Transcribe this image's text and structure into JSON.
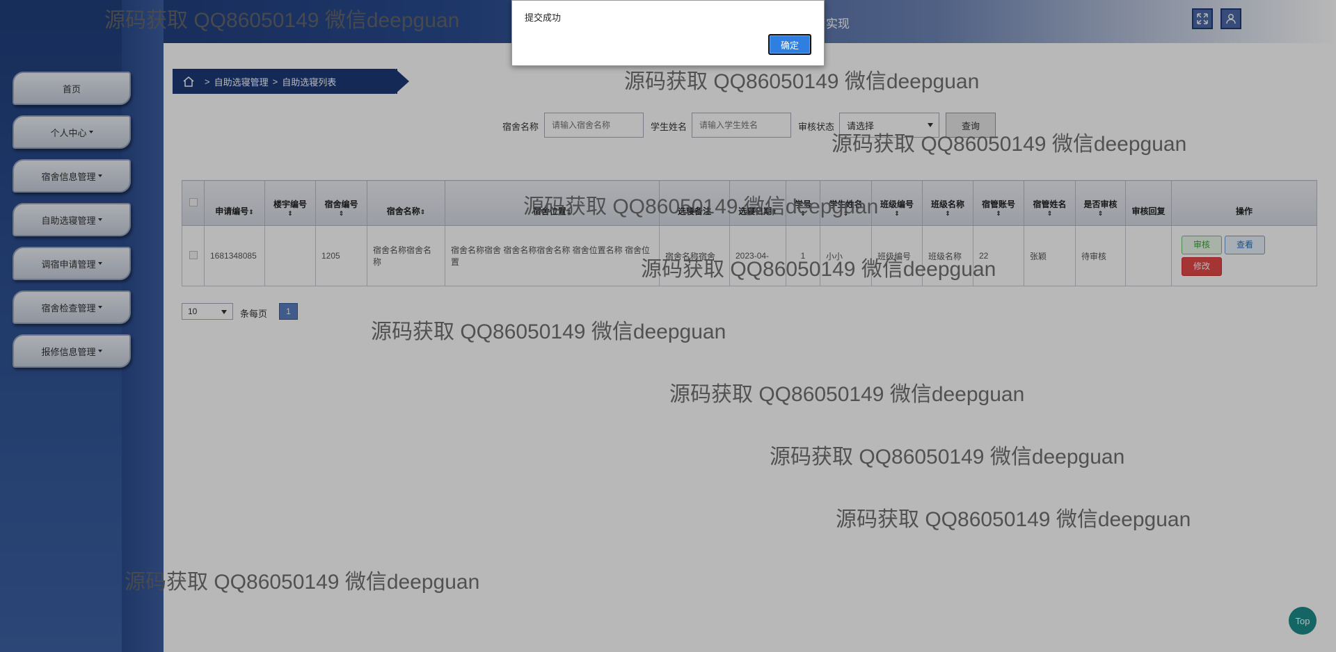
{
  "header": {
    "title_partial": "与实现"
  },
  "sidebar": {
    "items": [
      {
        "label": "首页",
        "has_caret": false
      },
      {
        "label": "个人中心",
        "has_caret": true
      },
      {
        "label": "宿舍信息管理",
        "has_caret": true
      },
      {
        "label": "自助选寝管理",
        "has_caret": true
      },
      {
        "label": "调宿申请管理",
        "has_caret": true
      },
      {
        "label": "宿舍检查管理",
        "has_caret": true
      },
      {
        "label": "报修信息管理",
        "has_caret": true
      }
    ]
  },
  "breadcrumb": {
    "sep": ">",
    "level1": "自助选寝管理",
    "level2": "自助选寝列表"
  },
  "search": {
    "dorm_name_label": "宿舍名称",
    "dorm_name_placeholder": "请输入宿舍名称",
    "student_name_label": "学生姓名",
    "student_name_placeholder": "请输入学生姓名",
    "status_label": "审核状态",
    "status_value": "请选择",
    "query_button": "查询"
  },
  "table": {
    "columns": [
      "申请编号",
      "楼宇编号",
      "宿舍编号",
      "宿舍名称",
      "宿舍位置",
      "选寝备注",
      "选寝日期",
      "学号",
      "学生姓名",
      "班级编号",
      "班级名称",
      "宿管账号",
      "宿管姓名",
      "是否审核",
      "审核回复",
      "操作"
    ],
    "rows": [
      {
        "id": "1681348085",
        "building": "",
        "room_no": "1205",
        "room_name": "宿舍名称宿舍名称",
        "location": "宿舍名称宿舍 宿舍名称宿舍名称 宿舍位置名称 宿舍位置",
        "remark": "宿舍名称宿舍",
        "date": "2023-04-",
        "student_no": "1",
        "student_name": "小小",
        "class_no": "班级编号",
        "class_name": "班级名称",
        "manager_account": "22",
        "manager_name": "张颖",
        "audit_status": "待审核",
        "reply": "",
        "actions": {
          "audit": "审核",
          "view": "查看",
          "edit": "修改"
        }
      }
    ]
  },
  "pagination": {
    "page_size": "10",
    "per_page_label": "条每页",
    "current_page": "1"
  },
  "dialog": {
    "message": "提交成功",
    "ok_label": "确定"
  },
  "watermark": {
    "text": "源码获取 QQ86050149 微信deepguan"
  },
  "top_button": "Top",
  "colors": {
    "primary": "#1d3a78",
    "accent": "#2f7fe0",
    "top": "#1f8c8c"
  }
}
